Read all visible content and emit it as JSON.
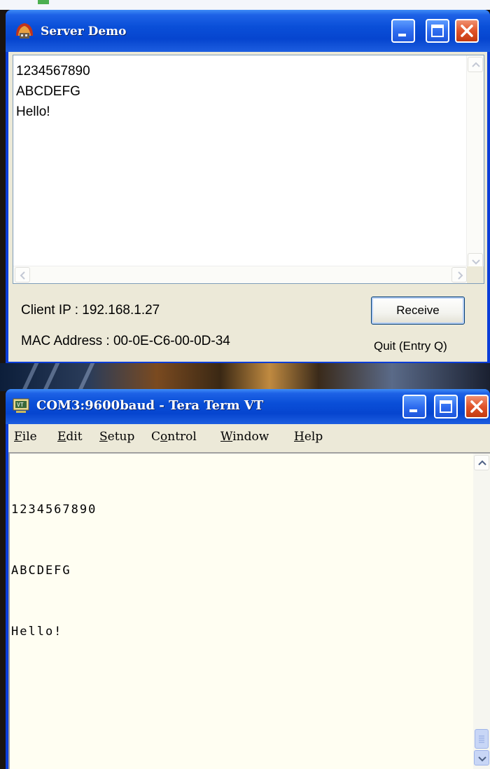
{
  "server_window": {
    "title": "Server Demo",
    "received_lines": [
      "1234567890",
      "ABCDEFG",
      "Hello!"
    ],
    "client_ip": "Client IP : 192.168.1.27",
    "mac_address": "MAC Address : 00-0E-C6-00-0D-34",
    "receive_button": "Receive",
    "quit_hint": "Quit (Entry Q)"
  },
  "terminal_window": {
    "title": "COM3:9600baud - Tera Term VT",
    "menu": [
      "File",
      "Edit",
      "Setup",
      "Control",
      "Window",
      "Help"
    ],
    "output_lines": [
      "1234567890",
      "ABCDEFG",
      "Hello!"
    ]
  },
  "colors": {
    "titlebar_blue": "#0a4fd8",
    "close_red": "#e0542a",
    "window_face": "#ece9d8",
    "terminal_bg": "#fffef2"
  },
  "icons": [
    "app-icon",
    "minimize-icon",
    "maximize-icon",
    "close-icon",
    "teraterm-icon",
    "scroll-up-icon",
    "scroll-down-icon",
    "scroll-left-icon",
    "scroll-right-icon"
  ]
}
